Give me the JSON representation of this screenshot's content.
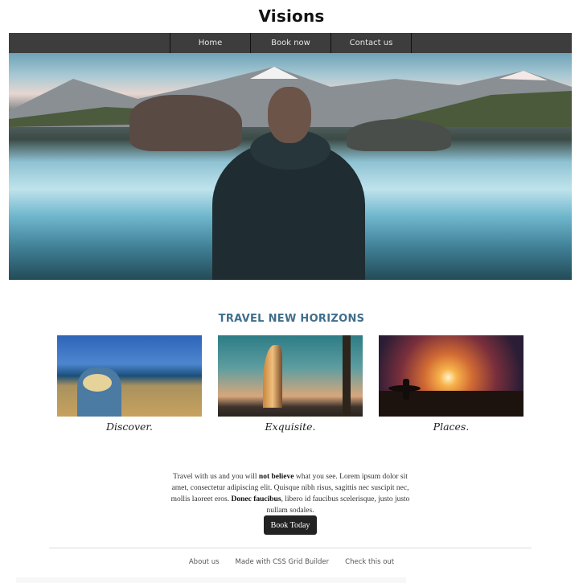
{
  "header": {
    "title": "Visions"
  },
  "nav": {
    "items": [
      {
        "label": "Home"
      },
      {
        "label": "Book now"
      },
      {
        "label": "Contact us"
      }
    ]
  },
  "hero": {
    "image": "mountain-lake-person-photo"
  },
  "main": {
    "heading": "TRAVEL NEW HORIZONS",
    "cards": [
      {
        "image": "woman-coast-photo",
        "caption": "Discover."
      },
      {
        "image": "burj-al-arab-photo",
        "caption": "Exquisite."
      },
      {
        "image": "surfer-sunset-photo",
        "caption": "Places."
      }
    ],
    "body": {
      "part1": "Travel with us and you will ",
      "bold1": "not believe",
      "part2": " what you see. Lorem ipsum dolor sit amet, consectetur adipiscing elit. Quisque nibh risus, sagittis nec suscipit nec, mollis laoreet eros. ",
      "bold2": "Donec faucibus",
      "part3": ", libero id faucibus scelerisque, justo justo nullam sodales."
    },
    "cta_label": "Book Today"
  },
  "footer": {
    "links": [
      {
        "label": "About us"
      },
      {
        "label": "Made with CSS Grid Builder"
      },
      {
        "label": "Check this out"
      }
    ]
  },
  "colors": {
    "nav_bg": "#3d3d3d",
    "heading": "#3f6e8c",
    "button_bg": "#222222"
  }
}
